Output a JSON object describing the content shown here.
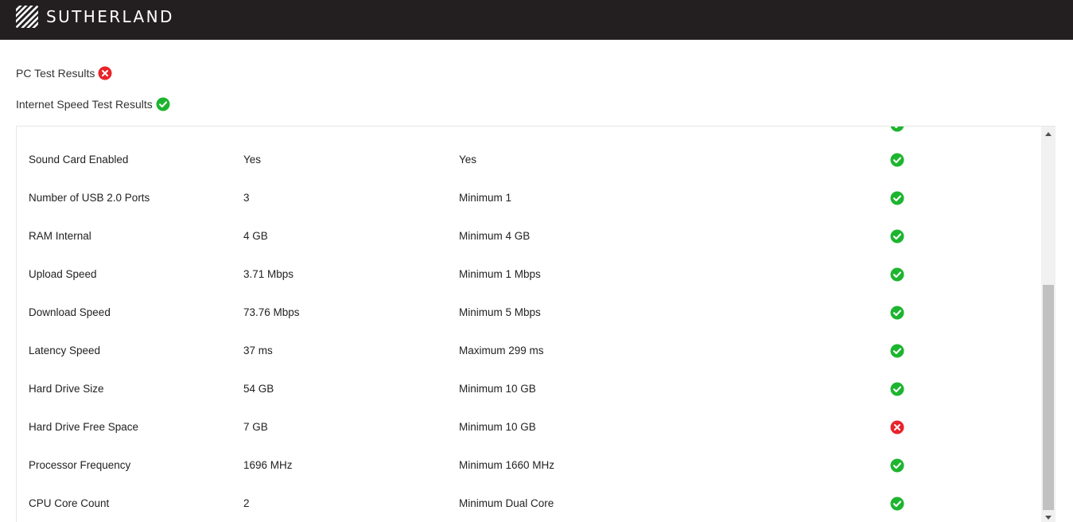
{
  "brand": {
    "name": "SUTHERLAND"
  },
  "summary": {
    "pc_test": {
      "label": "PC Test Results",
      "status": "fail"
    },
    "internet_test": {
      "label": "Internet Speed Test Results",
      "status": "pass"
    }
  },
  "colors": {
    "pass": "#1db52f",
    "fail": "#e8242b",
    "header_bg": "#231f20"
  },
  "results": {
    "rows": [
      {
        "name": "Sound Card Enabled",
        "value": "Yes",
        "requirement": "Yes",
        "status": "pass"
      },
      {
        "name": "Number of USB 2.0 Ports",
        "value": "3",
        "requirement": "Minimum 1",
        "status": "pass"
      },
      {
        "name": "RAM Internal",
        "value": "4 GB",
        "requirement": "Minimum 4 GB",
        "status": "pass"
      },
      {
        "name": "Upload Speed",
        "value": "3.71 Mbps",
        "requirement": "Minimum 1 Mbps",
        "status": "pass"
      },
      {
        "name": "Download Speed",
        "value": "73.76 Mbps",
        "requirement": "Minimum 5 Mbps",
        "status": "pass"
      },
      {
        "name": "Latency Speed",
        "value": "37 ms",
        "requirement": "Maximum 299 ms",
        "status": "pass"
      },
      {
        "name": "Hard Drive Size",
        "value": "54 GB",
        "requirement": "Minimum 10 GB",
        "status": "pass"
      },
      {
        "name": "Hard Drive Free Space",
        "value": "7 GB",
        "requirement": "Minimum 10 GB",
        "status": "fail"
      },
      {
        "name": "Processor Frequency",
        "value": "1696 MHz",
        "requirement": "Minimum 1660 MHz",
        "status": "pass"
      },
      {
        "name": "CPU Core Count",
        "value": "2",
        "requirement": "Minimum Dual Core",
        "status": "pass"
      }
    ]
  }
}
